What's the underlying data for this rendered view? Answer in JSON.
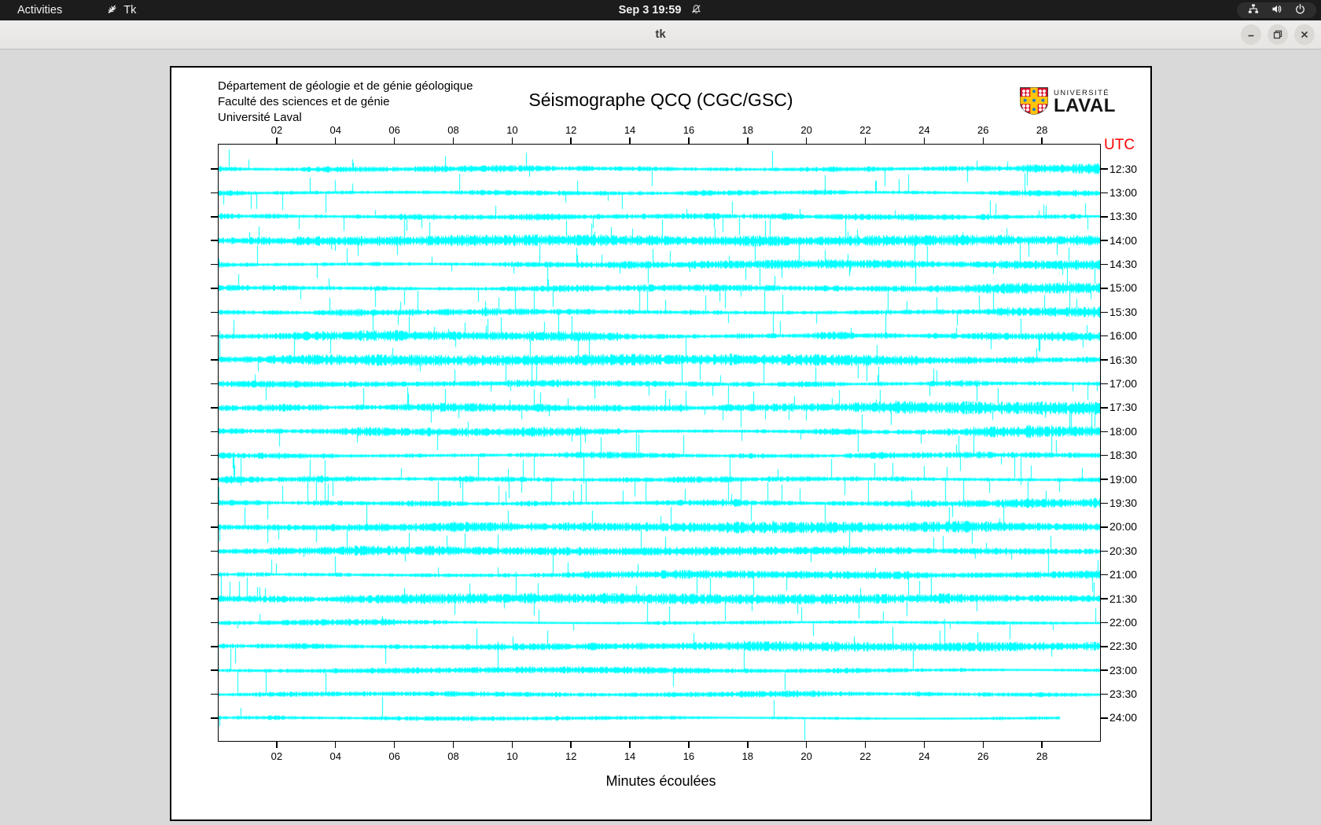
{
  "topbar": {
    "activities": "Activities",
    "app_name": "Tk",
    "clock": "Sep 3 19:59",
    "icons": [
      "tk-feather-icon",
      "bell-muted-icon",
      "network-wired-icon",
      "volume-icon",
      "power-icon"
    ]
  },
  "titlebar": {
    "title": "tk",
    "buttons": [
      "minimize",
      "restore",
      "close"
    ]
  },
  "window": {
    "header_lines": [
      "Département de géologie et de génie géologique",
      "Faculté des sciences et de génie",
      "Université Laval"
    ],
    "title": "Séismographe QCQ (CGC/GSC)",
    "logo": {
      "line1": "UNIVERSITÉ",
      "line2": "LAVAL"
    }
  },
  "colors": {
    "trace": "#00ffff",
    "utc_red": "#ff0000",
    "laval_red": "#d6112b",
    "laval_gold": "#ffc40c",
    "laval_blue": "#1f7fc2"
  },
  "chart_data": {
    "type": "line",
    "subtype": "helicorder-seismogram",
    "title": "Séismographe QCQ (CGC/GSC)",
    "xlabel": "Minutes écoulées",
    "utc_axis_label": "UTC",
    "x_range_minutes": [
      0,
      30
    ],
    "x_ticks": [
      "02",
      "04",
      "06",
      "08",
      "10",
      "12",
      "14",
      "16",
      "18",
      "20",
      "22",
      "24",
      "26",
      "28"
    ],
    "grid": false,
    "trace_color": "#00ffff",
    "row_spacing_px": 30.3913,
    "traces": [
      {
        "utc": "12:30",
        "band": 3.0,
        "rate": 0.02,
        "max": 26,
        "end": 1.0
      },
      {
        "utc": "13:00",
        "band": 3.0,
        "rate": 0.022,
        "max": 30,
        "end": 1.0
      },
      {
        "utc": "13:30",
        "band": 3.2,
        "rate": 0.02,
        "max": 26,
        "end": 1.0
      },
      {
        "utc": "14:00",
        "band": 2.9,
        "rate": 0.022,
        "max": 32,
        "end": 1.0
      },
      {
        "utc": "14:30",
        "band": 3.0,
        "rate": 0.024,
        "max": 26,
        "end": 1.0
      },
      {
        "utc": "15:00",
        "band": 2.9,
        "rate": 0.02,
        "max": 34,
        "end": 1.0
      },
      {
        "utc": "15:30",
        "band": 3.0,
        "rate": 0.02,
        "max": 40,
        "end": 1.0
      },
      {
        "utc": "16:00",
        "band": 3.0,
        "rate": 0.02,
        "max": 28,
        "end": 1.0
      },
      {
        "utc": "16:30",
        "band": 3.0,
        "rate": 0.02,
        "max": 42,
        "end": 1.0
      },
      {
        "utc": "17:00",
        "band": 3.2,
        "rate": 0.024,
        "max": 30,
        "end": 1.0
      },
      {
        "utc": "17:30",
        "band": 3.4,
        "rate": 0.028,
        "max": 26,
        "end": 1.0
      },
      {
        "utc": "18:00",
        "band": 3.2,
        "rate": 0.024,
        "max": 30,
        "end": 1.0
      },
      {
        "utc": "18:30",
        "band": 3.0,
        "rate": 0.02,
        "max": 40,
        "end": 1.0
      },
      {
        "utc": "19:00",
        "band": 3.2,
        "rate": 0.024,
        "max": 30,
        "end": 1.0
      },
      {
        "utc": "19:30",
        "band": 3.2,
        "rate": 0.024,
        "max": 34,
        "end": 1.0
      },
      {
        "utc": "20:00",
        "band": 3.0,
        "rate": 0.02,
        "max": 30,
        "end": 1.0
      },
      {
        "utc": "20:30",
        "band": 2.6,
        "rate": 0.016,
        "max": 24,
        "end": 1.0
      },
      {
        "utc": "21:00",
        "band": 2.8,
        "rate": 0.018,
        "max": 30,
        "end": 1.0
      },
      {
        "utc": "21:30",
        "band": 2.8,
        "rate": 0.018,
        "max": 34,
        "end": 1.0
      },
      {
        "utc": "22:00",
        "band": 2.2,
        "rate": 0.01,
        "max": 22,
        "end": 1.0
      },
      {
        "utc": "22:30",
        "band": 2.6,
        "rate": 0.014,
        "max": 40,
        "end": 1.0
      },
      {
        "utc": "23:00",
        "band": 1.8,
        "rate": 0.005,
        "max": 42,
        "end": 1.0
      },
      {
        "utc": "23:30",
        "band": 1.8,
        "rate": 0.004,
        "max": 32,
        "end": 1.0
      },
      {
        "utc": "24:00",
        "band": 1.6,
        "rate": 0.004,
        "max": 34,
        "end": 0.954
      }
    ]
  }
}
